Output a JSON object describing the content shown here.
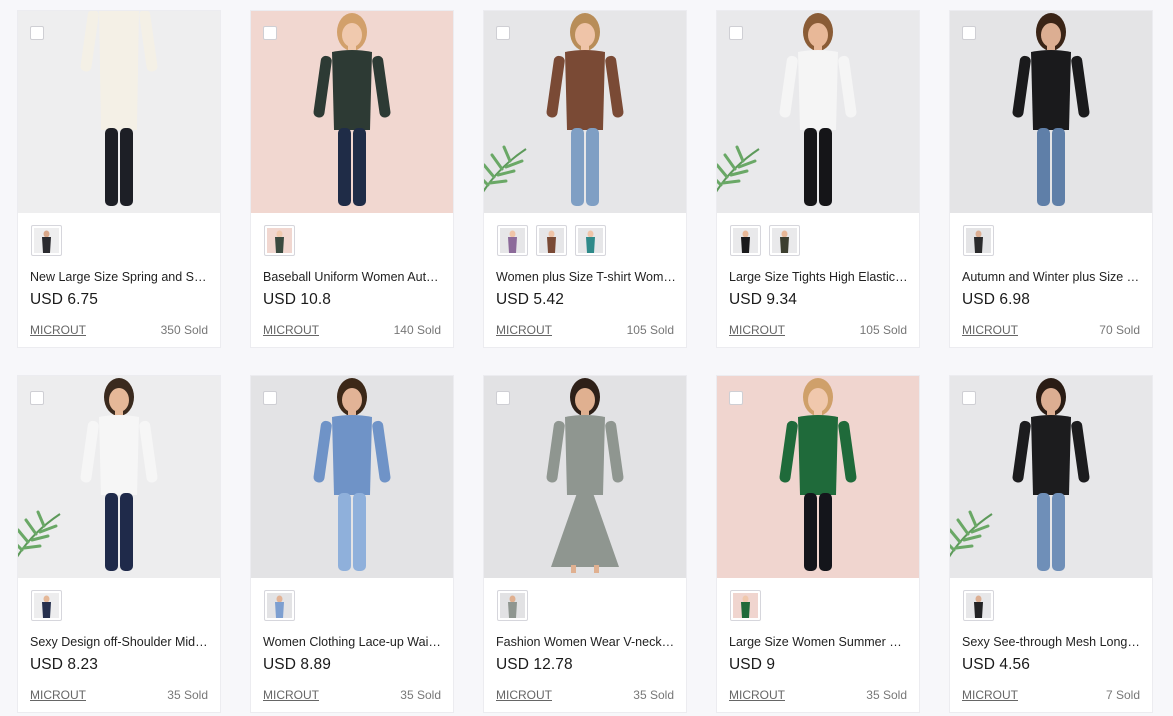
{
  "products": [
    {
      "title": "New Large Size Spring and Sum...",
      "price": "USD 6.75",
      "store": "MICROUT",
      "sold": "350 Sold",
      "bg": "#eeeeef",
      "top": "#f4f0e6",
      "bottom": "#1d1f26",
      "skin": "#d9a88a",
      "hair": "#3a2a20",
      "swatches": [
        "#2b2b30"
      ],
      "headless": true
    },
    {
      "title": "Baseball Uniform Women Autu...",
      "price": "USD 10.8",
      "store": "MICROUT",
      "sold": "140 Sold",
      "bg": "#f1d7d0",
      "top": "#2d3a34",
      "bottom": "#1f2c47",
      "skin": "#f0c9ae",
      "hair": "#d2a06b",
      "swatches": [
        "#3a4a40"
      ]
    },
    {
      "title": "Women plus Size T-shirt Wome...",
      "price": "USD 5.42",
      "store": "MICROUT",
      "sold": "105 Sold",
      "bg": "#e6e6e8",
      "top": "#7a4a35",
      "bottom": "#7f9fc4",
      "skin": "#efc4a8",
      "hair": "#b88d58",
      "swatches": [
        "#8c6a9a",
        "#7a4a35",
        "#2f8a8a"
      ],
      "plant": true
    },
    {
      "title": "Large Size Tights High Elastic Le...",
      "price": "USD 9.34",
      "store": "MICROUT",
      "sold": "105 Sold",
      "bg": "#e9e9eb",
      "top": "#f5f5f5",
      "bottom": "#151518",
      "skin": "#e8b898",
      "hair": "#8a5c36",
      "swatches": [
        "#1a1a1c",
        "#3d3f30"
      ],
      "plant": true
    },
    {
      "title": "Autumn and Winter plus Size W...",
      "price": "USD 6.98",
      "store": "MICROUT",
      "sold": "70 Sold",
      "bg": "#e4e4e6",
      "top": "#1a1a1c",
      "bottom": "#5f7fa8",
      "skin": "#dcae92",
      "hair": "#3a2416",
      "swatches": [
        "#2a2a2c"
      ]
    },
    {
      "title": "Sexy Design off-Shoulder Mid-L...",
      "price": "USD 8.23",
      "store": "MICROUT",
      "sold": "35 Sold",
      "bg": "#ededee",
      "top": "#f6f6f6",
      "bottom": "#1f2a4a",
      "skin": "#e5b898",
      "hair": "#3a2a1e",
      "swatches": [
        "#26304e"
      ],
      "plant": true
    },
    {
      "title": "Women Clothing Lace-up Waist...",
      "price": "USD 8.89",
      "store": "MICROUT",
      "sold": "35 Sold",
      "bg": "#e3e3e5",
      "top": "#6f93c7",
      "bottom": "#8fb0db",
      "skin": "#e2b396",
      "hair": "#3c2818",
      "swatches": [
        "#7d9fd0"
      ]
    },
    {
      "title": "Fashion Women Wear V-neck S...",
      "price": "USD 12.78",
      "store": "MICROUT",
      "sold": "35 Sold",
      "bg": "#e2e2e4",
      "top": "#8f9690",
      "bottom": "#8f9690",
      "skin": "#e0b090",
      "hair": "#2e2018",
      "swatches": [
        "#8f9690"
      ],
      "dress": true
    },
    {
      "title": "Large Size Women Summer Styl...",
      "price": "USD 9",
      "store": "MICROUT",
      "sold": "35 Sold",
      "bg": "#f0d5cf",
      "top": "#1f6a3a",
      "bottom": "#14151b",
      "skin": "#f0c8ad",
      "hair": "#cfa06a",
      "swatches": [
        "#1f6a3a"
      ]
    },
    {
      "title": "Sexy See-through Mesh Long Sl...",
      "price": "USD 4.56",
      "store": "MICROUT",
      "sold": "7 Sold",
      "bg": "#e7e7e9",
      "top": "#1c1c1e",
      "bottom": "#6f8fb8",
      "skin": "#dcae92",
      "hair": "#2a1c14",
      "swatches": [
        "#232325"
      ],
      "plant": true
    }
  ]
}
